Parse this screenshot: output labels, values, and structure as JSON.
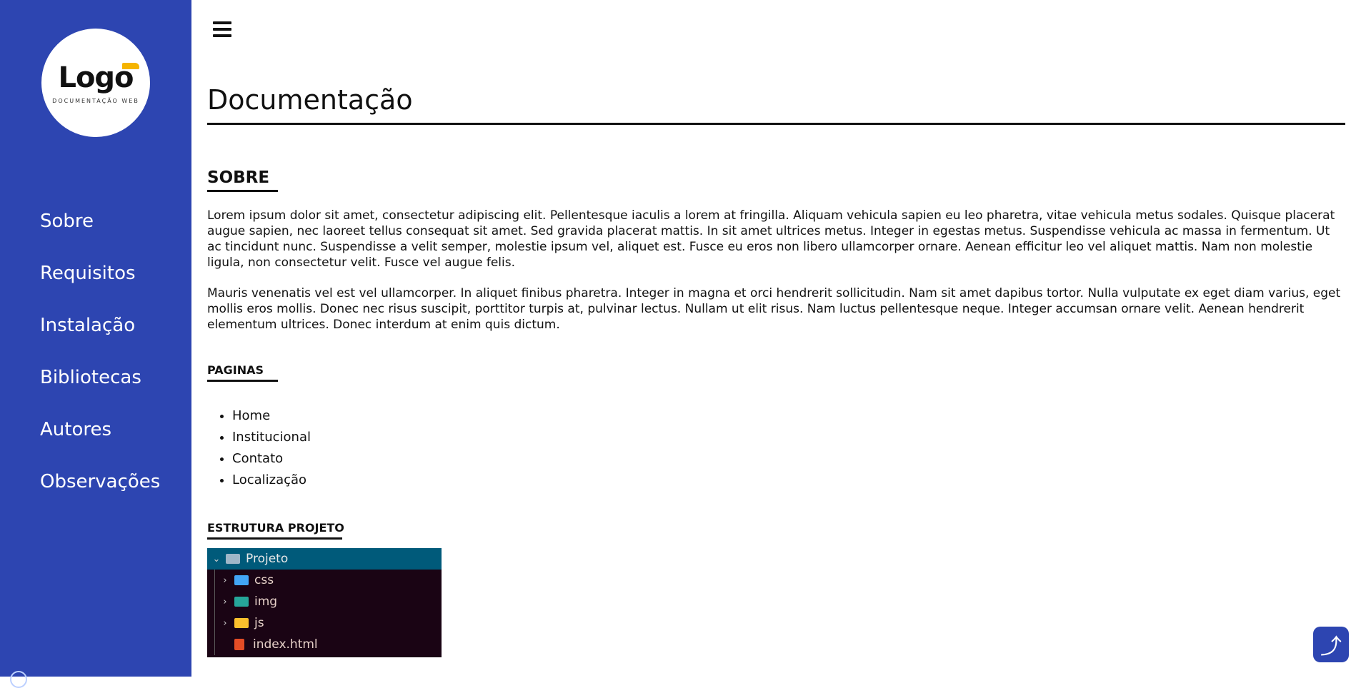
{
  "sidebar": {
    "logo": {
      "word": "Logo",
      "subtitle": "DOCUMENTAÇÃO WEB",
      "accent_color": "#f5b400"
    },
    "background_color": "#2d45b1",
    "items": [
      {
        "label": "Sobre"
      },
      {
        "label": "Requisitos"
      },
      {
        "label": "Instalação"
      },
      {
        "label": "Bibliotecas"
      },
      {
        "label": "Autores"
      },
      {
        "label": "Observações"
      }
    ]
  },
  "header": {
    "menu_icon": "hamburger-icon"
  },
  "main": {
    "title": "Documentação",
    "sobre": {
      "heading": "SOBRE",
      "paragraphs": [
        "Lorem ipsum dolor sit amet, consectetur adipiscing elit. Pellentesque iaculis a lorem at fringilla. Aliquam vehicula sapien eu leo pharetra, vitae vehicula metus sodales. Quisque placerat augue sapien, nec laoreet tellus consequat sit amet. Sed gravida placerat mattis. In sit amet ultrices metus. Integer in egestas metus. Suspendisse vehicula ac massa in fermentum. Ut ac tincidunt nunc. Suspendisse a velit semper, molestie ipsum vel, aliquet est. Fusce eu eros non libero ullamcorper ornare. Aenean efficitur leo vel aliquet mattis. Nam non molestie ligula, non consectetur velit. Fusce vel augue felis.",
        "Mauris venenatis vel est vel ullamcorper. In aliquet finibus pharetra. Integer in magna et orci hendrerit sollicitudin. Nam sit amet dapibus tortor. Nulla vulputate ex eget diam varius, eget mollis eros mollis. Donec nec risus suscipit, porttitor turpis at, pulvinar lectus. Nullam ut elit risus. Nam luctus pellentesque neque. Integer accumsan ornare velit. Aenean hendrerit elementum ultrices. Donec interdum at enim quis dictum."
      ]
    },
    "paginas": {
      "heading": "PAGINAS",
      "items": [
        "Home",
        "Institucional",
        "Contato",
        "Localização"
      ]
    },
    "estrutura": {
      "heading": "ESTRUTURA PROJETO",
      "tree": {
        "root": "Projeto",
        "children": [
          {
            "name": "css",
            "icon": "folder-css-icon",
            "color": "#42a5f5"
          },
          {
            "name": "img",
            "icon": "folder-image-icon",
            "color": "#26a69a"
          },
          {
            "name": "js",
            "icon": "folder-js-icon",
            "color": "#fbc02d"
          },
          {
            "name": "index.html",
            "icon": "html5-icon",
            "color": "#e44d26"
          }
        ]
      }
    }
  },
  "scroll_top": {
    "icon": "arrow-up-icon"
  }
}
